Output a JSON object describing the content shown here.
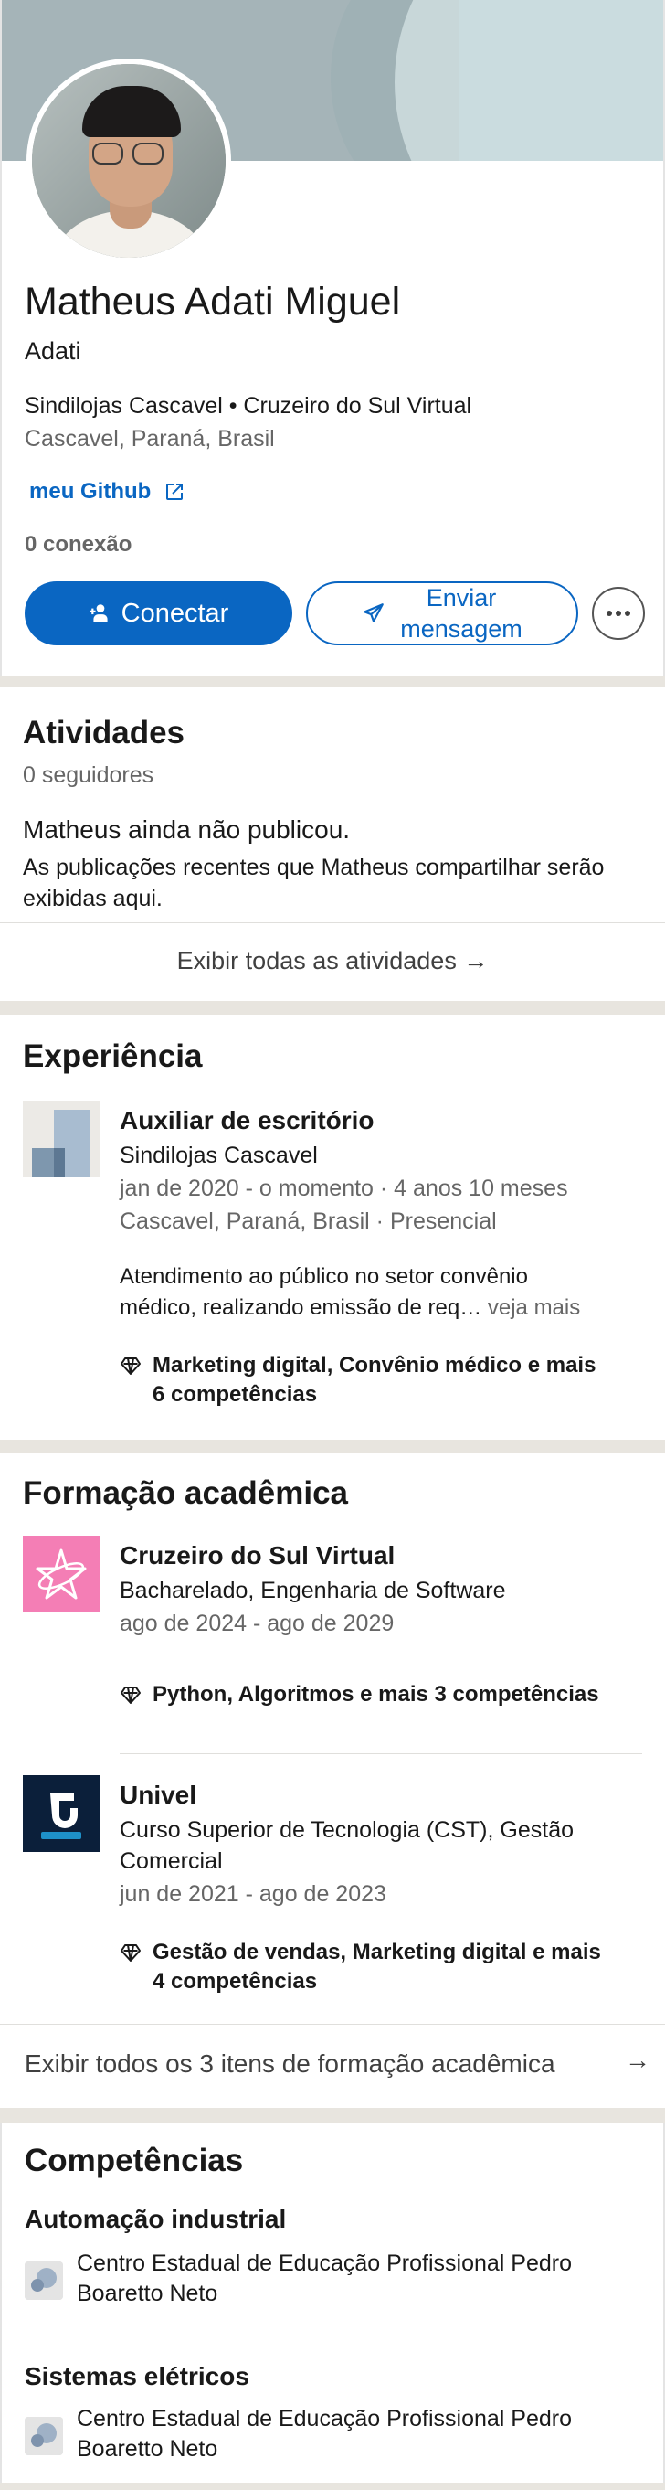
{
  "profile": {
    "name": "Matheus Adati Miguel",
    "headline": "Adati",
    "organizations": "Sindilojas Cascavel • Cruzeiro do Sul Virtual",
    "location": "Cascavel, Paraná, Brasil",
    "link_label": "meu Github",
    "connections": "0 conexão",
    "connect_label": "Conectar",
    "message_label_line1": "Enviar",
    "message_label_line2": "mensagem"
  },
  "activities": {
    "title": "Atividades",
    "followers": "0 seguidores",
    "empty_title": "Matheus ainda não publicou.",
    "empty_desc": "As publicações recentes que Matheus compartilhar serão exibidas aqui.",
    "show_all": "Exibir todas as atividades →"
  },
  "experience": {
    "title": "Experiência",
    "items": [
      {
        "role": "Auxiliar de escritório",
        "company": "Sindilojas Cascavel",
        "period": "jan de 2020 - o momento · 4 anos 10 meses",
        "place": "Cascavel, Paraná, Brasil · Presencial",
        "description_line1": "Atendimento ao público no setor convênio",
        "description_line2": "médico, realizando emissão de req…",
        "see_more": " veja mais",
        "skills_line1": "Marketing digital, Convênio médico e mais",
        "skills_line2": "6 competências"
      }
    ]
  },
  "education": {
    "title": "Formação acadêmica",
    "items": [
      {
        "school": "Cruzeiro do Sul Virtual",
        "degree": "Bacharelado, Engenharia de Software",
        "period": "ago de 2024 - ago de 2029",
        "skills": "Python, Algoritmos e mais 3 competências"
      },
      {
        "school": "Univel",
        "degree_line1": "Curso Superior de Tecnologia (CST), Gestão",
        "degree_line2": "Comercial",
        "period": "jun de 2021 - ago de 2023",
        "skills_line1": "Gestão de vendas, Marketing digital e mais",
        "skills_line2": "4 competências"
      }
    ],
    "show_all": "Exibir todos os 3 itens de formação acadêmica",
    "arrow": "→"
  },
  "skills": {
    "title": "Competências",
    "items": [
      {
        "name": "Automação industrial",
        "source_line1": "Centro Estadual de Educação Profissional Pedro",
        "source_line2": "Boaretto Neto"
      },
      {
        "name": "Sistemas elétricos",
        "source_line1": "Centro Estadual de Educação Profissional Pedro",
        "source_line2": "Boaretto Neto"
      }
    ]
  },
  "colors": {
    "primary": "#0a66c2",
    "divider": "#e8e5df",
    "text": "#191919",
    "muted": "#666666"
  }
}
